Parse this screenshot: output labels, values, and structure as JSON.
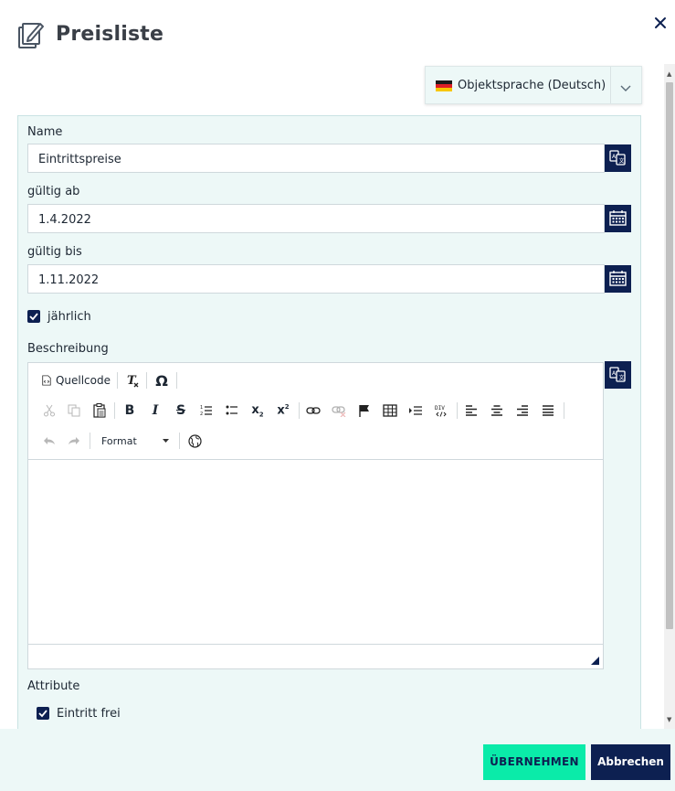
{
  "header": {
    "title": "Preisliste",
    "title_icon": "edit-notes-icon",
    "close_icon": "close-icon"
  },
  "language": {
    "selected": "Objektsprache (Deutsch)",
    "flag": "de-flag"
  },
  "form": {
    "name": {
      "label": "Name",
      "value": "Eintrittspreise"
    },
    "valid_from": {
      "label": "gültig ab",
      "value": "1.4.2022"
    },
    "valid_to": {
      "label": "gültig bis",
      "value": "1.11.2022"
    },
    "yearly": {
      "label": "jährlich",
      "checked": true
    },
    "description": {
      "label": "Beschreibung",
      "value": ""
    },
    "attributes": {
      "label": "Attribute",
      "items": [
        {
          "label": "Eintritt frei",
          "checked": true
        }
      ]
    }
  },
  "editor_toolbar": {
    "source_label": "Quellcode",
    "format_label": "Format"
  },
  "footer": {
    "apply_label": "ÜBERNEHMEN",
    "cancel_label": "Abbrechen"
  },
  "colors": {
    "navy": "#0d2051",
    "accent": "#0aeba9",
    "panel_bg": "#edf8f7"
  }
}
